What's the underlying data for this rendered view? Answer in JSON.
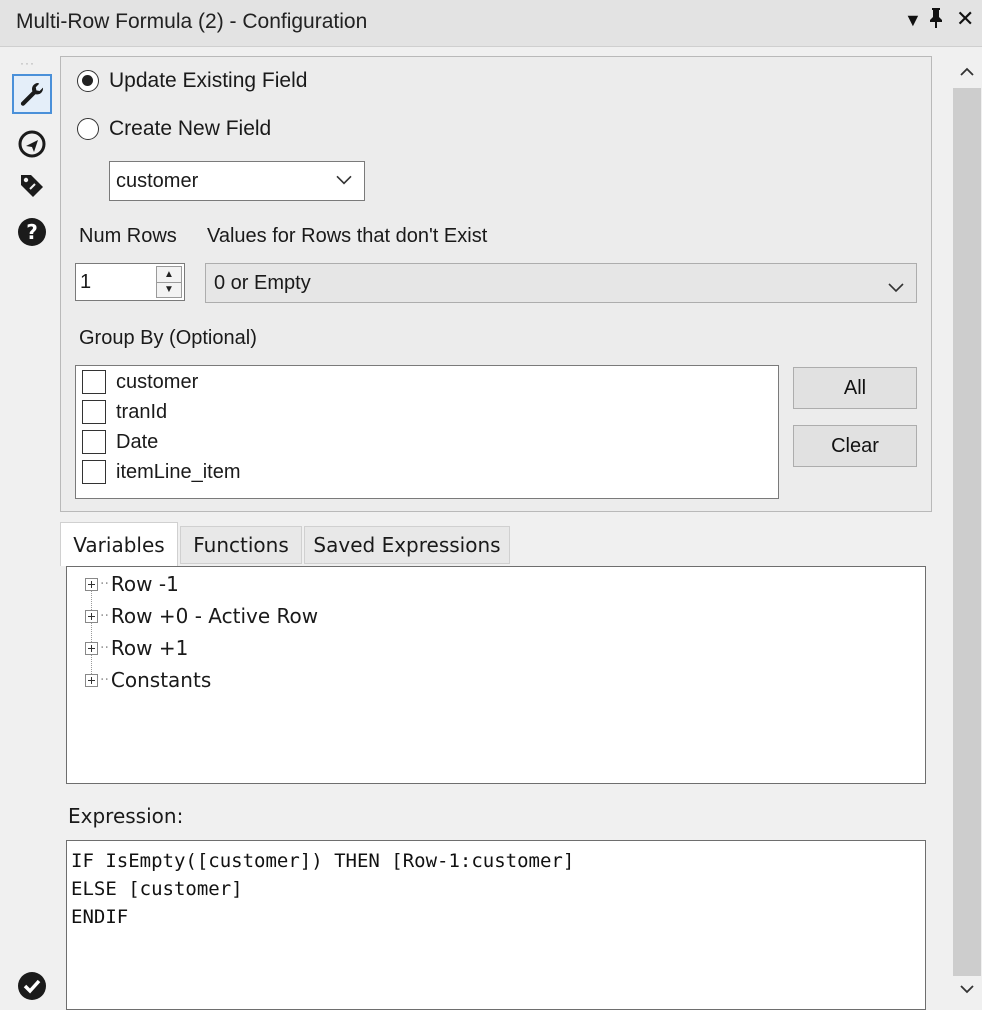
{
  "window": {
    "title": "Multi-Row Formula (2) - Configuration",
    "controls": {
      "menu": "▾",
      "pin": "📌",
      "close": "✕"
    }
  },
  "sidebar": {
    "items": [
      {
        "icon": "wrench-icon",
        "active": true
      },
      {
        "icon": "navigate-icon",
        "active": false
      },
      {
        "icon": "tag-icon",
        "active": false
      },
      {
        "icon": "help-icon",
        "active": false
      }
    ],
    "status_icon": "check-circle-icon"
  },
  "config": {
    "update_existing_label": "Update Existing Field",
    "create_new_label": "Create New  Field",
    "field_select_value": "customer",
    "num_rows_label": "Num Rows",
    "num_rows_value": "1",
    "values_missing_label": "Values for Rows that don't Exist",
    "values_missing_value": "0 or Empty",
    "group_by_label": "Group By (Optional)",
    "group_by_fields": [
      "customer",
      "tranId",
      "Date",
      "itemLine_item"
    ],
    "all_button": "All",
    "clear_button": "Clear"
  },
  "tabs": [
    "Variables",
    "Functions",
    "Saved Expressions"
  ],
  "active_tab": "Variables",
  "tree": {
    "items": [
      "Row -1",
      "Row +0 - Active Row",
      "Row +1",
      "Constants"
    ]
  },
  "expression": {
    "label": "Expression:",
    "text": "IF IsEmpty([customer]) THEN [Row-1:customer]\nELSE [customer]\nENDIF"
  }
}
